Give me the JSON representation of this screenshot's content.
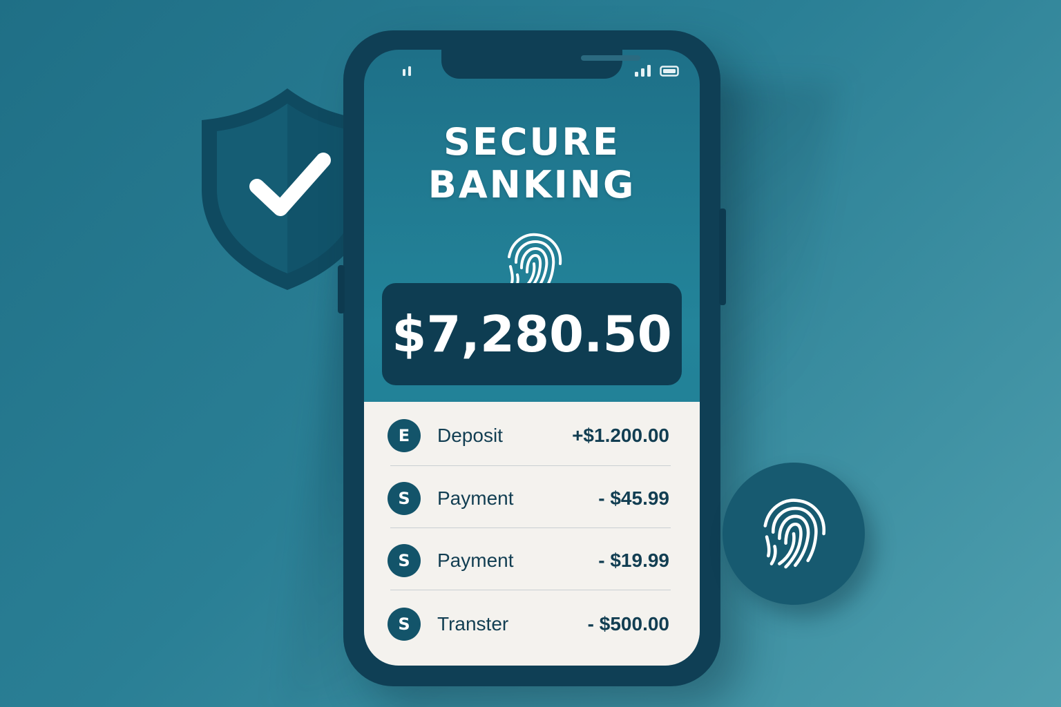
{
  "app": {
    "title_line1": "SECURE",
    "title_line2": "BANKING"
  },
  "status_bar": {
    "signal_icon": "signal-bars-icon",
    "battery_icon": "battery-icon"
  },
  "balance": {
    "amount": "$7,280.50"
  },
  "transactions": [
    {
      "icon_glyph": "E",
      "label": "Deposit",
      "amount": "+$1.200.00"
    },
    {
      "icon_glyph": "S",
      "label": "Payment",
      "amount": "- $45.99"
    },
    {
      "icon_glyph": "S",
      "label": "Payment",
      "amount": "- $19.99"
    },
    {
      "icon_glyph": "S",
      "label": "Transter",
      "amount": "- $500.00"
    }
  ],
  "icons": {
    "shield": "shield-check-icon",
    "fingerprint": "fingerprint-icon"
  },
  "colors": {
    "background": "#2a7f95",
    "phone_frame": "#0f3f55",
    "card": "#0e3d52",
    "panel": "#f4f2ee",
    "text_dark": "#123e52"
  }
}
